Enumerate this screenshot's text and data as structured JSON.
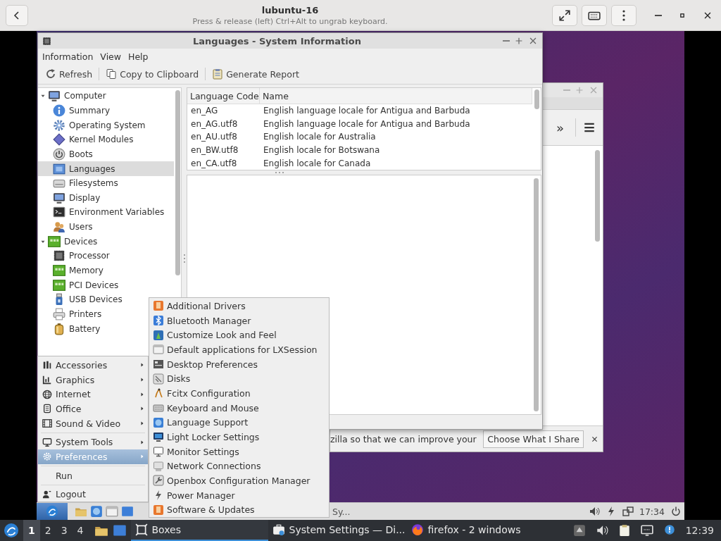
{
  "host_header": {
    "title": "lubuntu-16",
    "subtitle": "Press & release (left) Ctrl+Alt to ungrab keyboard."
  },
  "background_window": {
    "toolbar_overflow": "»",
    "notification": {
      "text": "zilla so that we can improve your",
      "button": "Choose What I Share"
    }
  },
  "window": {
    "title": "Languages - System Information",
    "menu": [
      "Information",
      "View",
      "Help"
    ],
    "toolbar": [
      "Refresh",
      "Copy to Clipboard",
      "Generate Report"
    ],
    "tree": [
      {
        "label": "Computer",
        "expanded": true,
        "selected": false,
        "children": [
          {
            "label": "Summary",
            "selected": false
          },
          {
            "label": "Operating System",
            "selected": false
          },
          {
            "label": "Kernel Modules",
            "selected": false
          },
          {
            "label": "Boots",
            "selected": false
          },
          {
            "label": "Languages",
            "selected": true
          },
          {
            "label": "Filesystems",
            "selected": false
          },
          {
            "label": "Display",
            "selected": false
          },
          {
            "label": "Environment Variables",
            "selected": false
          },
          {
            "label": "Users",
            "selected": false
          }
        ]
      },
      {
        "label": "Devices",
        "expanded": true,
        "selected": false,
        "children": [
          {
            "label": "Processor",
            "selected": false
          },
          {
            "label": "Memory",
            "selected": false
          },
          {
            "label": "PCI Devices",
            "selected": false
          },
          {
            "label": "USB Devices",
            "selected": false
          },
          {
            "label": "Printers",
            "selected": false
          },
          {
            "label": "Battery",
            "selected": false
          }
        ]
      }
    ],
    "table": {
      "columns": [
        "Language Code",
        "Name"
      ],
      "rows": [
        {
          "code": "en_AG",
          "name": "English language locale for Antigua and Barbuda"
        },
        {
          "code": "en_AG.utf8",
          "name": "English language locale for Antigua and Barbuda"
        },
        {
          "code": "en_AU.utf8",
          "name": "English locale for Australia"
        },
        {
          "code": "en_BW.utf8",
          "name": "English locale for Botswana"
        },
        {
          "code": "en_CA.utf8",
          "name": "English locale for Canada"
        }
      ]
    }
  },
  "start_menu": {
    "groups": [
      [
        {
          "label": "Accessories",
          "submenu": true,
          "selected": false
        },
        {
          "label": "Graphics",
          "submenu": true,
          "selected": false
        },
        {
          "label": "Internet",
          "submenu": true,
          "selected": false
        },
        {
          "label": "Office",
          "submenu": true,
          "selected": false
        },
        {
          "label": "Sound & Video",
          "submenu": true,
          "selected": false
        }
      ],
      [
        {
          "label": "System Tools",
          "submenu": true,
          "selected": false
        },
        {
          "label": "Preferences",
          "submenu": true,
          "selected": true
        }
      ],
      [
        {
          "label": "Run",
          "submenu": false,
          "selected": false
        }
      ],
      [
        {
          "label": "Logout",
          "submenu": false,
          "selected": false
        }
      ]
    ]
  },
  "preferences_menu": [
    "Additional Drivers",
    "Bluetooth Manager",
    "Customize Look and Feel",
    "Default applications for LXSession",
    "Desktop Preferences",
    "Disks",
    "Fcitx Configuration",
    "Keyboard and Mouse",
    "Language Support",
    "Light Locker Settings",
    "Monitor Settings",
    "Network Connections",
    "Openbox Configuration Manager",
    "Power Manager",
    "Software & Updates"
  ],
  "vm_panel": {
    "task": "Sy...",
    "clock": "17:34"
  },
  "taskbar": {
    "workspaces": [
      {
        "label": "1",
        "selected": true
      },
      {
        "label": "2",
        "selected": false
      },
      {
        "label": "3",
        "selected": false
      },
      {
        "label": "4",
        "selected": false
      }
    ],
    "tasks": [
      {
        "label": "Boxes",
        "selected": true
      },
      {
        "label": "System Settings — Di...",
        "selected": false
      },
      {
        "label": "firefox - 2 windows",
        "selected": false
      }
    ],
    "clock": "12:39"
  }
}
